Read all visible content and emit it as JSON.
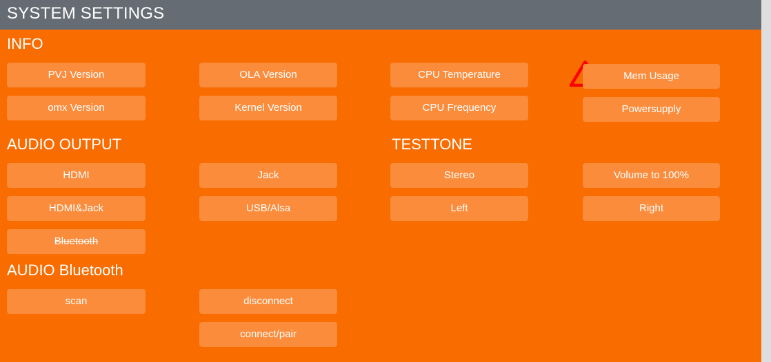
{
  "window": {
    "title": "SYSTEM SETTINGS"
  },
  "colors": {
    "header_bg": "#666c73",
    "page_bg": "#f86c00",
    "button_bg": "#fb8c3c",
    "text": "#ffffff",
    "warning_outline": "#ff0000",
    "warning_mark": "#000000",
    "scrollbar_track": "#dedede"
  },
  "status": {
    "warning_icon": "warning-triangle-icon"
  },
  "sections": [
    {
      "id": "info",
      "title": "INFO",
      "buttons": [
        {
          "label": "PVJ Version",
          "column": 1,
          "row": 1,
          "disabled": false
        },
        {
          "label": "omx Version",
          "column": 1,
          "row": 2,
          "disabled": false
        },
        {
          "label": "OLA Version",
          "column": 2,
          "row": 1,
          "disabled": false
        },
        {
          "label": "Kernel Version",
          "column": 2,
          "row": 2,
          "disabled": false
        },
        {
          "label": "CPU Temperature",
          "column": 3,
          "row": 1,
          "disabled": false
        },
        {
          "label": "CPU Frequency",
          "column": 3,
          "row": 2,
          "disabled": false
        },
        {
          "label": "Mem Usage",
          "column": 4,
          "row": 1,
          "disabled": false
        },
        {
          "label": "Powersupply",
          "column": 4,
          "row": 2,
          "disabled": false
        }
      ]
    },
    {
      "id": "audio-output",
      "title": "AUDIO OUTPUT",
      "buttons": [
        {
          "label": "HDMI",
          "column": 1,
          "row": 1,
          "disabled": false
        },
        {
          "label": "HDMI&Jack",
          "column": 1,
          "row": 2,
          "disabled": false
        },
        {
          "label": "Bluetooth",
          "column": 1,
          "row": 3,
          "disabled": true
        },
        {
          "label": "Jack",
          "column": 2,
          "row": 1,
          "disabled": false
        },
        {
          "label": "USB/Alsa",
          "column": 2,
          "row": 2,
          "disabled": false
        }
      ]
    },
    {
      "id": "testtone",
      "title": "TESTTONE",
      "buttons": [
        {
          "label": "Stereo",
          "column": 3,
          "row": 1,
          "disabled": false
        },
        {
          "label": "Left",
          "column": 3,
          "row": 2,
          "disabled": false
        },
        {
          "label": "Volume to 100%",
          "column": 4,
          "row": 1,
          "disabled": false
        },
        {
          "label": "Right",
          "column": 4,
          "row": 2,
          "disabled": false
        }
      ]
    },
    {
      "id": "audio-bluetooth",
      "title": "AUDIO Bluetooth",
      "buttons": [
        {
          "label": "scan",
          "column": 1,
          "row": 1,
          "disabled": false
        },
        {
          "label": "disconnect",
          "column": 2,
          "row": 1,
          "disabled": false
        },
        {
          "label": "connect/pair",
          "column": 2,
          "row": 2,
          "disabled": false
        }
      ]
    }
  ]
}
